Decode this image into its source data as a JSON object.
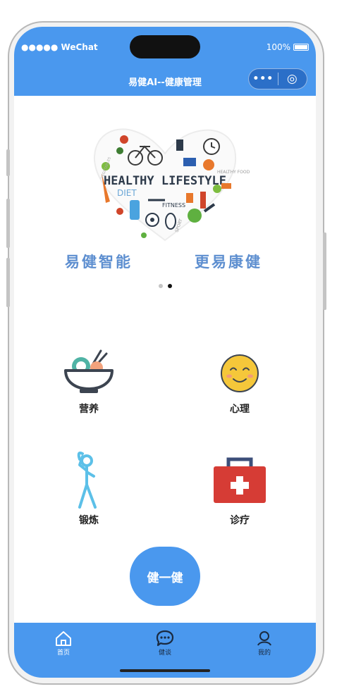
{
  "status": {
    "carrier": "●●●●● WeChat",
    "battery": "100%"
  },
  "nav": {
    "title": "易健AI--健康管理",
    "more_glyph": "•••",
    "close_glyph": "◎"
  },
  "banner": {
    "art_text": [
      "HEALTHY LIFESTYLE",
      "DIET",
      "FITNESS",
      "HEALTHY FOOD",
      "SPORT",
      "VEGETABLES"
    ],
    "slogan_left": "易健智能",
    "slogan_right": "更易康健",
    "slides": 2,
    "active_slide": 2
  },
  "categories": [
    {
      "label": "营养",
      "icon": "food-bowl-icon"
    },
    {
      "label": "心理",
      "icon": "smiley-face-icon"
    },
    {
      "label": "锻炼",
      "icon": "exercise-figure-icon"
    },
    {
      "label": "诊疗",
      "icon": "first-aid-kit-icon"
    }
  ],
  "fab": {
    "label": "健一健"
  },
  "tabs": [
    {
      "label": "首页",
      "icon": "home-icon"
    },
    {
      "label": "健谈",
      "icon": "chat-bubble-icon"
    },
    {
      "label": "我的",
      "icon": "person-icon"
    }
  ],
  "colors": {
    "primary": "#4a98ee",
    "slogan": "#5e8fd0",
    "kit_red": "#d63c35",
    "smiley_yellow": "#f5c73a"
  }
}
